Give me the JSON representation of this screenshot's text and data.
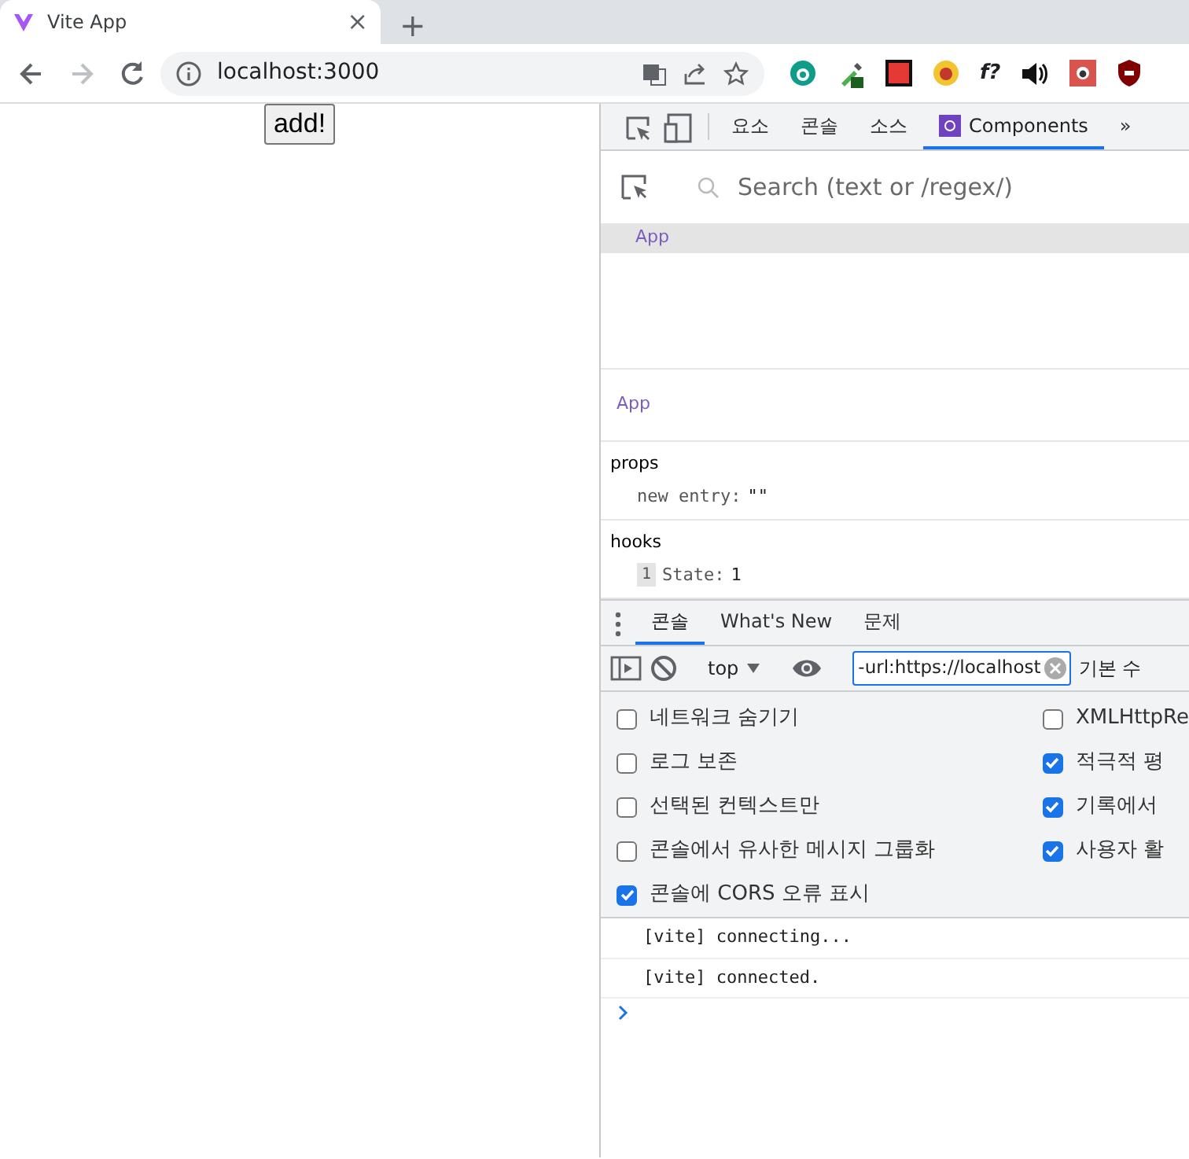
{
  "browser": {
    "tab": {
      "title": "Vite App",
      "close": "×"
    },
    "new_tab": "+",
    "address": "localhost:3000",
    "extension_text": "f?"
  },
  "page": {
    "button": "add!"
  },
  "devtools": {
    "tabs": [
      {
        "label": "요소",
        "selected": false
      },
      {
        "label": "콘솔",
        "selected": false
      },
      {
        "label": "소스",
        "selected": false
      },
      {
        "label": "Components",
        "selected": true
      }
    ],
    "more": "»",
    "components": {
      "search": {
        "placeholder": "Search (text or /regex/)"
      },
      "tree": [
        {
          "label": "App",
          "selected": true
        }
      ],
      "inspector": {
        "title": "App",
        "sections": [
          {
            "title": "props",
            "items": [
              {
                "key": "new entry:",
                "value": "\"\""
              }
            ]
          },
          {
            "title": "hooks",
            "items": [
              {
                "index": "1",
                "key": "State:",
                "value": "1"
              }
            ]
          }
        ]
      }
    },
    "drawer": {
      "tabs": [
        {
          "label": "콘솔",
          "selected": true
        },
        {
          "label": "What's New",
          "selected": false
        },
        {
          "label": "문제",
          "selected": false
        }
      ],
      "context": "top",
      "filter": "-url:https://localhost",
      "levels": "기본 수",
      "settings_left": [
        {
          "label": "네트워크 숨기기",
          "checked": false
        },
        {
          "label": "로그 보존",
          "checked": false
        },
        {
          "label": "선택된 컨텍스트만",
          "checked": false
        },
        {
          "label": "콘솔에서 유사한 메시지 그룹화",
          "checked": false
        },
        {
          "label": "콘솔에 CORS 오류 표시",
          "checked": true
        }
      ],
      "settings_right": [
        {
          "label": "XMLHttpRe",
          "checked": false
        },
        {
          "label": "적극적 평",
          "checked": true
        },
        {
          "label": "기록에서",
          "checked": true
        },
        {
          "label": "사용자 활",
          "checked": true
        }
      ],
      "messages": [
        "[vite] connecting...",
        "[vite] connected."
      ]
    }
  }
}
